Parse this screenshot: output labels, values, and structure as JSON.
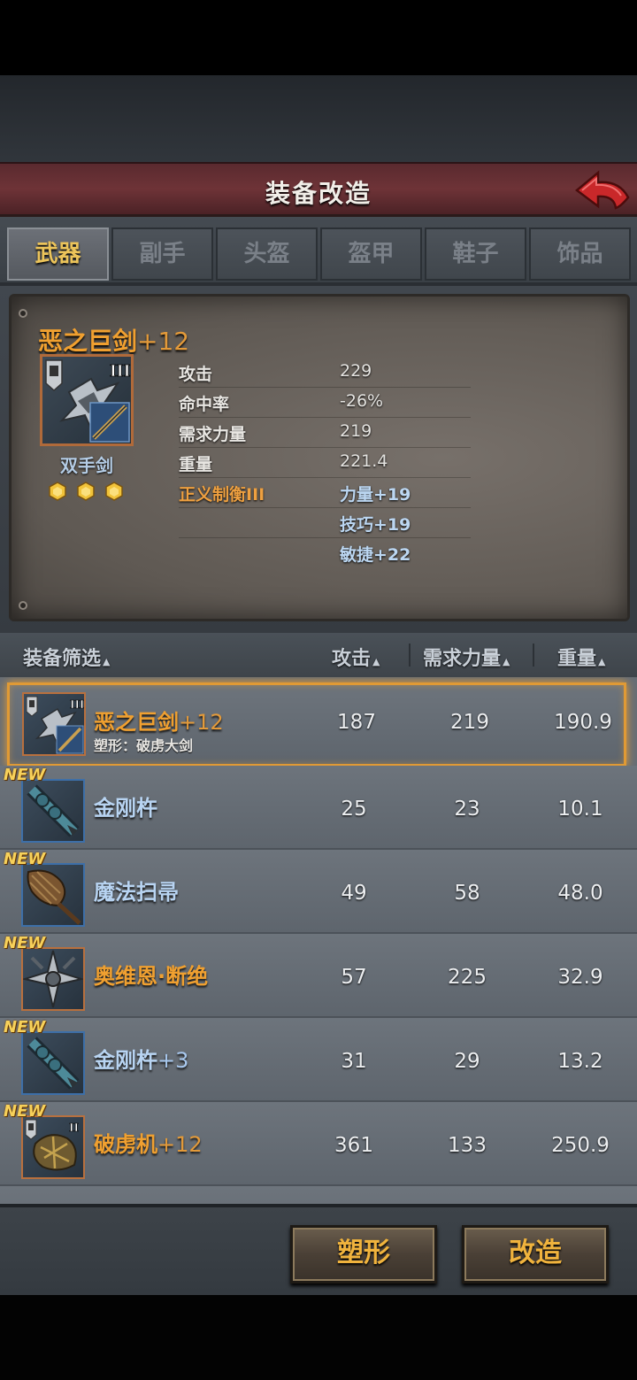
{
  "header": {
    "title": "装备改造"
  },
  "tabs": [
    {
      "label": "武器",
      "active": true
    },
    {
      "label": "副手",
      "active": false
    },
    {
      "label": "头盔",
      "active": false
    },
    {
      "label": "盔甲",
      "active": false
    },
    {
      "label": "鞋子",
      "active": false
    },
    {
      "label": "饰品",
      "active": false
    }
  ],
  "detail": {
    "name": "恶之巨剑",
    "plus": "+12",
    "tier": "III",
    "type": "双手剑",
    "gems": 3,
    "stats": [
      {
        "label": "攻击",
        "value": "229"
      },
      {
        "label": "命中率",
        "value": "-26%"
      },
      {
        "label": "需求力量",
        "value": "219"
      },
      {
        "label": "重量",
        "value": "221.4"
      },
      {
        "label": "正义制衡III",
        "value": "力量+19"
      },
      {
        "label": "",
        "value": "技巧+19"
      },
      {
        "label": "",
        "value": "敏捷+22"
      }
    ]
  },
  "filter": {
    "name": "装备筛选",
    "attack": "攻击",
    "strength": "需求力量",
    "weight": "重量"
  },
  "items": [
    {
      "name": "恶之巨剑",
      "plus": "+12",
      "sub": "塑形：破虏大剑",
      "attack": "187",
      "strength": "219",
      "weight": "190.9",
      "new": "",
      "tier": "III",
      "icon": "great-sword-icon",
      "selected": true
    },
    {
      "name": "金刚杵",
      "plus": "",
      "sub": "",
      "attack": "25",
      "strength": "23",
      "weight": "10.1",
      "new": "NEW",
      "tier": "",
      "icon": "vajra-icon",
      "selected": false
    },
    {
      "name": "魔法扫帚",
      "plus": "",
      "sub": "",
      "attack": "49",
      "strength": "58",
      "weight": "48.0",
      "new": "NEW",
      "tier": "",
      "icon": "broom-icon",
      "selected": false
    },
    {
      "name": "奥维恩·断绝",
      "plus": "",
      "sub": "",
      "attack": "57",
      "strength": "225",
      "weight": "32.9",
      "new": "NEW",
      "tier": "",
      "icon": "cross-blade-icon",
      "selected": false
    },
    {
      "name": "金刚杵",
      "plus": "+3",
      "sub": "",
      "attack": "31",
      "strength": "29",
      "weight": "13.2",
      "new": "NEW",
      "tier": "",
      "icon": "vajra-icon",
      "selected": false
    },
    {
      "name": "破虏机",
      "plus": "+12",
      "sub": "",
      "attack": "361",
      "strength": "133",
      "weight": "250.9",
      "new": "NEW",
      "tier": "II",
      "icon": "siege-engine-icon",
      "selected": false
    }
  ],
  "buttons": {
    "shape": "塑形",
    "modify": "改造"
  },
  "colors": {
    "accent": "#f0a030",
    "header": "#6e3337",
    "blue_text": "#b8d4f2"
  }
}
